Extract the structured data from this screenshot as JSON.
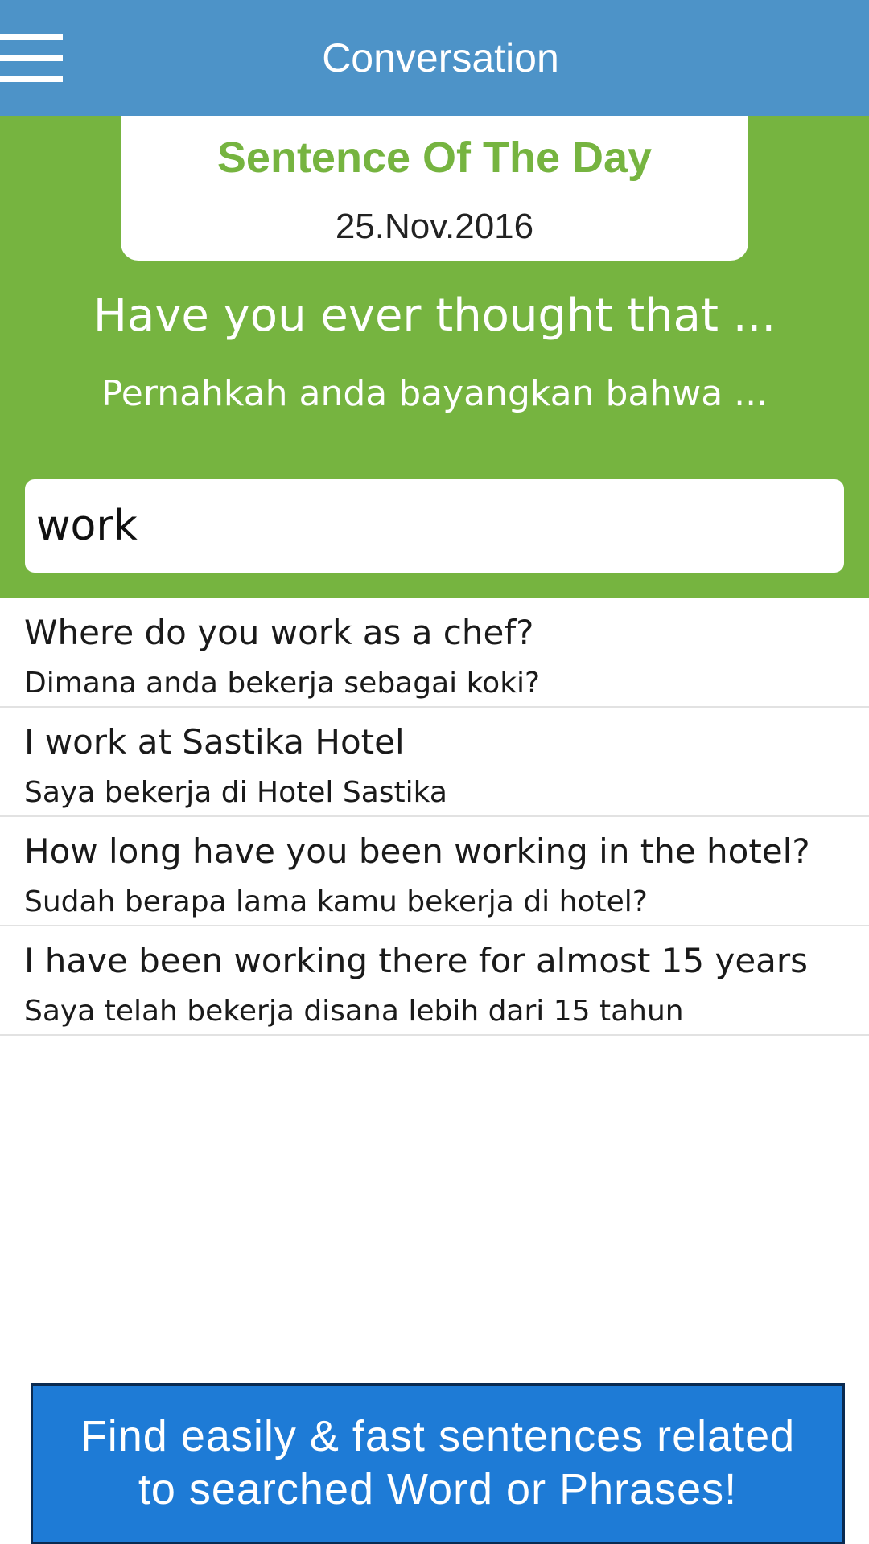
{
  "header": {
    "title": "Conversation",
    "menu_icon": "hamburger-menu-icon"
  },
  "sentence_of_the_day": {
    "title": "Sentence Of The Day",
    "date": "25.Nov.2016",
    "english": "Have you ever thought that ...",
    "indonesian": "Pernahkah anda bayangkan bahwa ..."
  },
  "search": {
    "value": "work",
    "placeholder": ""
  },
  "results": [
    {
      "english": "Where do you work as a chef?",
      "indonesian": "Dimana anda bekerja sebagai koki?"
    },
    {
      "english": "I work at Sastika Hotel",
      "indonesian": "Saya bekerja di Hotel Sastika"
    },
    {
      "english": "How long have you been working in the hotel?",
      "indonesian": "Sudah berapa lama kamu bekerja di hotel?"
    },
    {
      "english": "I have been working there for almost 15 years",
      "indonesian": "Saya telah bekerja disana lebih dari 15 tahun"
    }
  ],
  "banner": {
    "line1": "Find easily & fast sentences related",
    "line2": "to searched Word or Phrases!"
  },
  "colors": {
    "header": "#4d93c8",
    "accent_green": "#76b440",
    "banner_blue": "#1e7bd6"
  }
}
